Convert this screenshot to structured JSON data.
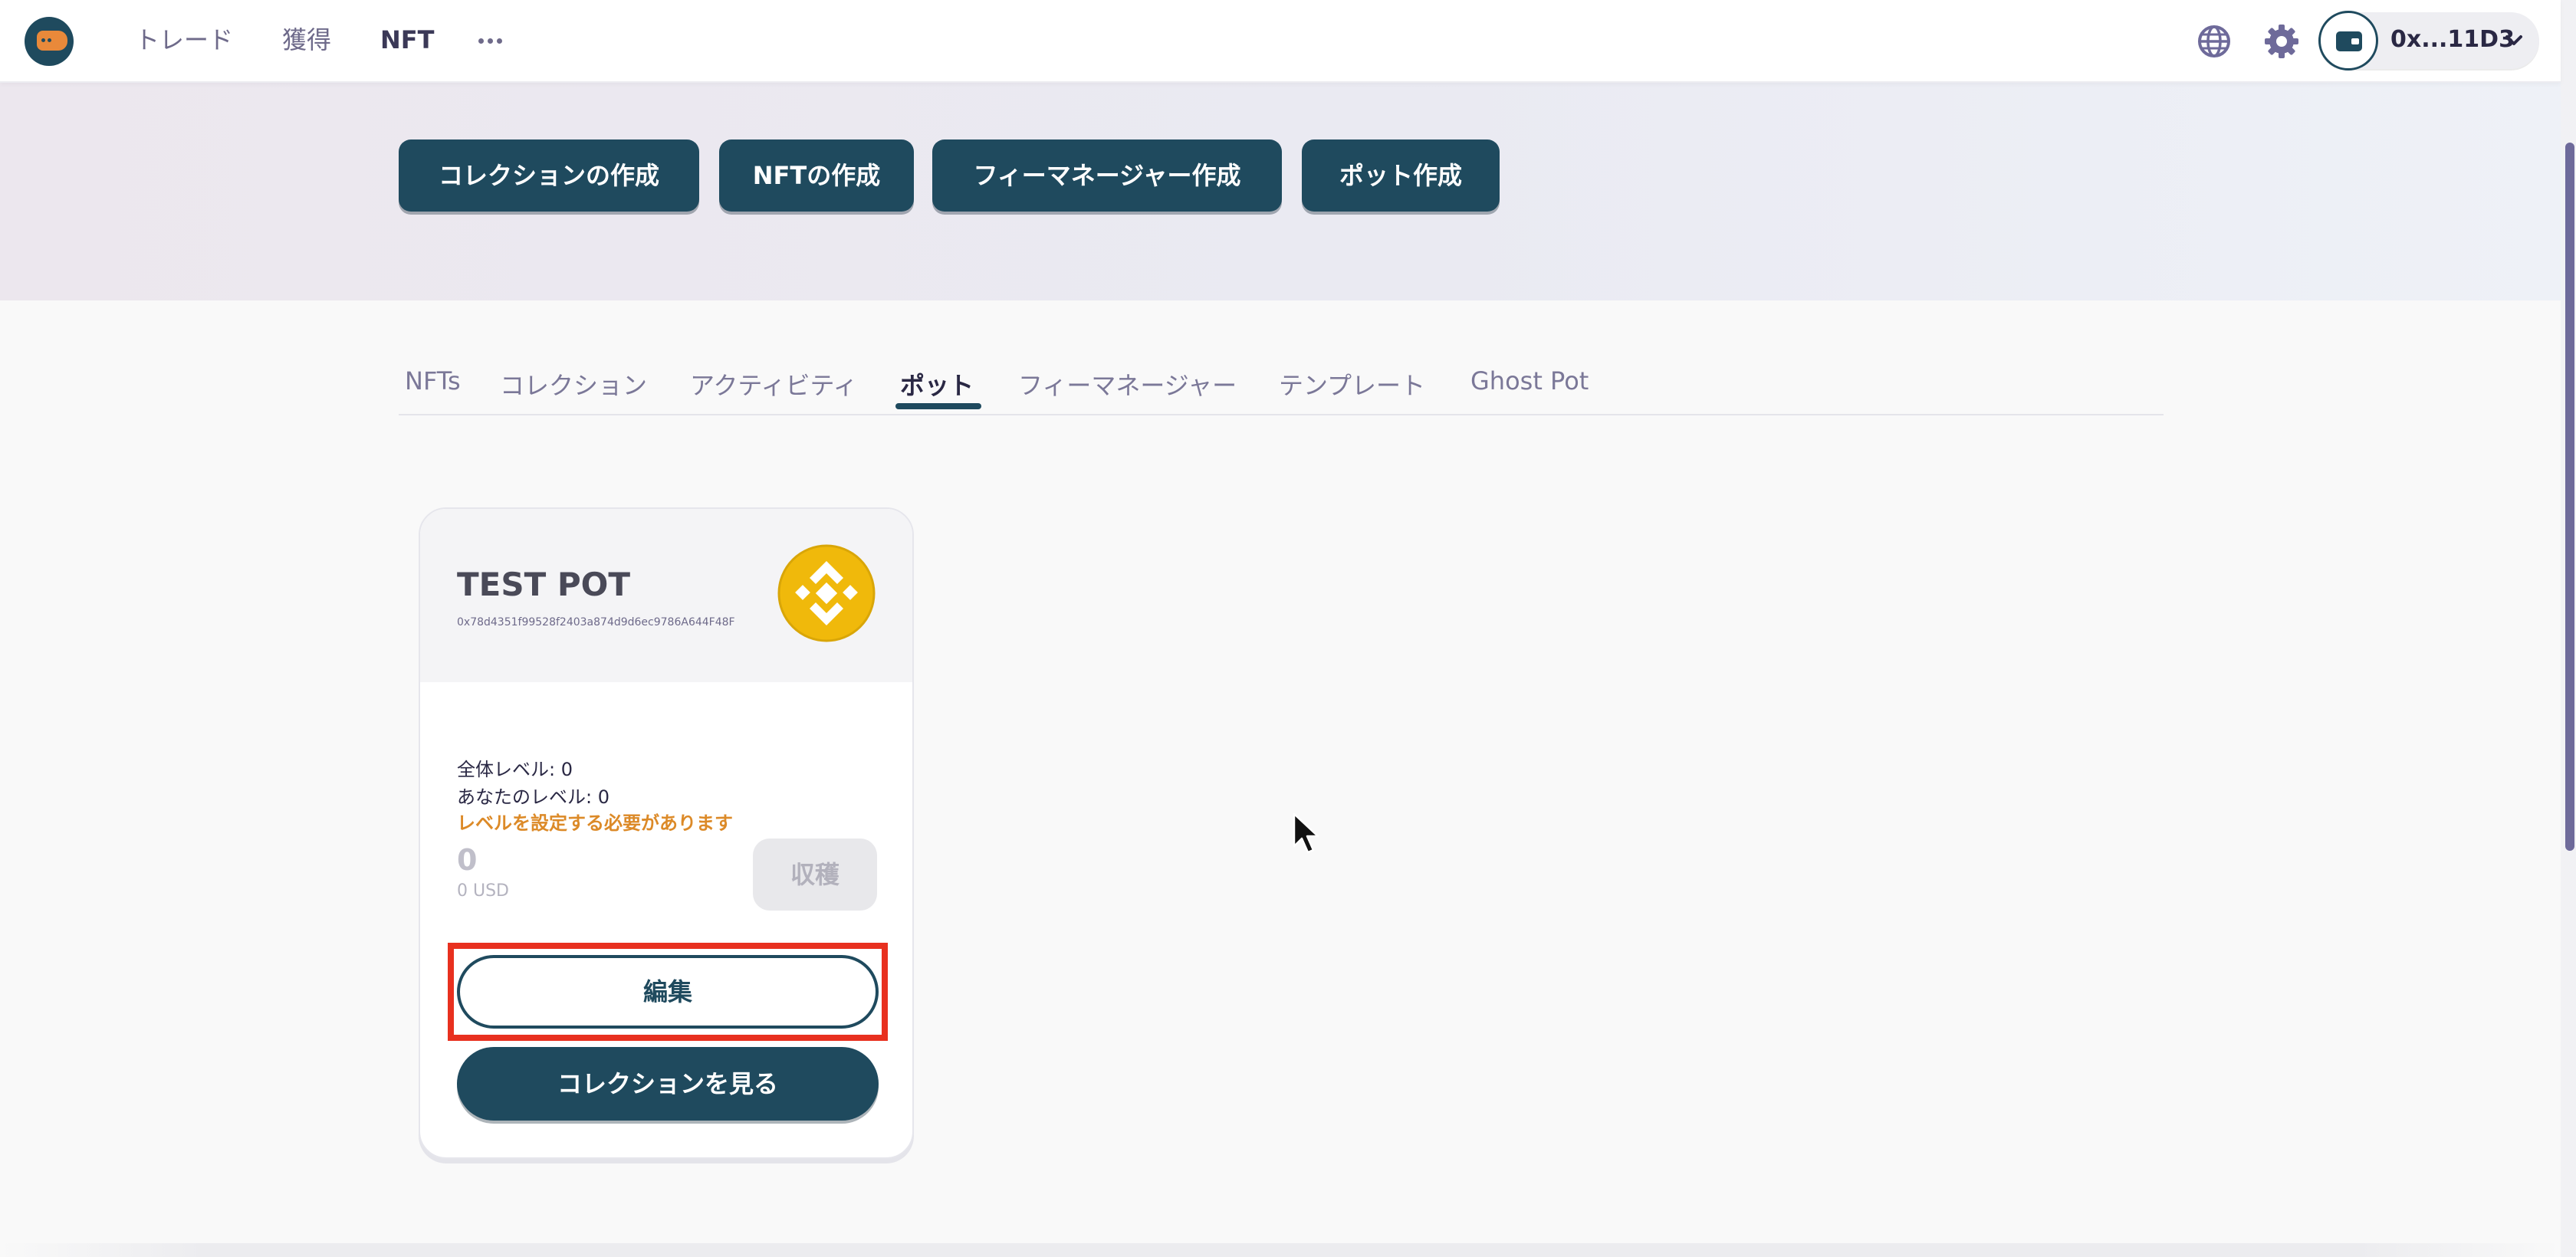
{
  "nav": {
    "links": [
      "トレード",
      "獲得",
      "NFT"
    ],
    "more_icon": "ellipsis-icon",
    "language_icon": "globe-icon",
    "settings_icon": "gear-icon",
    "wallet": {
      "icon": "wallet-icon",
      "address": "0x...11D3",
      "chevron_icon": "chevron-down-icon"
    }
  },
  "hero": {
    "buttons": [
      "コレクションの作成",
      "NFTの作成",
      "フィーマネージャー作成",
      "ポット作成"
    ]
  },
  "tabs": {
    "items": [
      "NFTs",
      "コレクション",
      "アクティビティ",
      "ポット",
      "フィーマネージャー",
      "テンプレート",
      "Ghost Pot"
    ],
    "active": "ポット"
  },
  "pot_card": {
    "title": "TEST POT",
    "address": "0x78d4351f99528f2403a874d9d6ec9786A644F48F",
    "token_icon": "bnb-icon",
    "token_color": "#f0b90b",
    "overall_level": "全体レベル: 0",
    "your_level": "あなたのレベル: 0",
    "warning": "レベルを設定する必要があります",
    "amount": "0",
    "amount_usd": "0 USD",
    "harvest_label": "収穫",
    "edit_label": "編集",
    "view_collection_label": "コレクションを見る"
  },
  "colors": {
    "primary": "#1f4a5e",
    "warning": "#dc8a28",
    "highlight": "#e8301f",
    "accent_logo": "#e9893a"
  }
}
